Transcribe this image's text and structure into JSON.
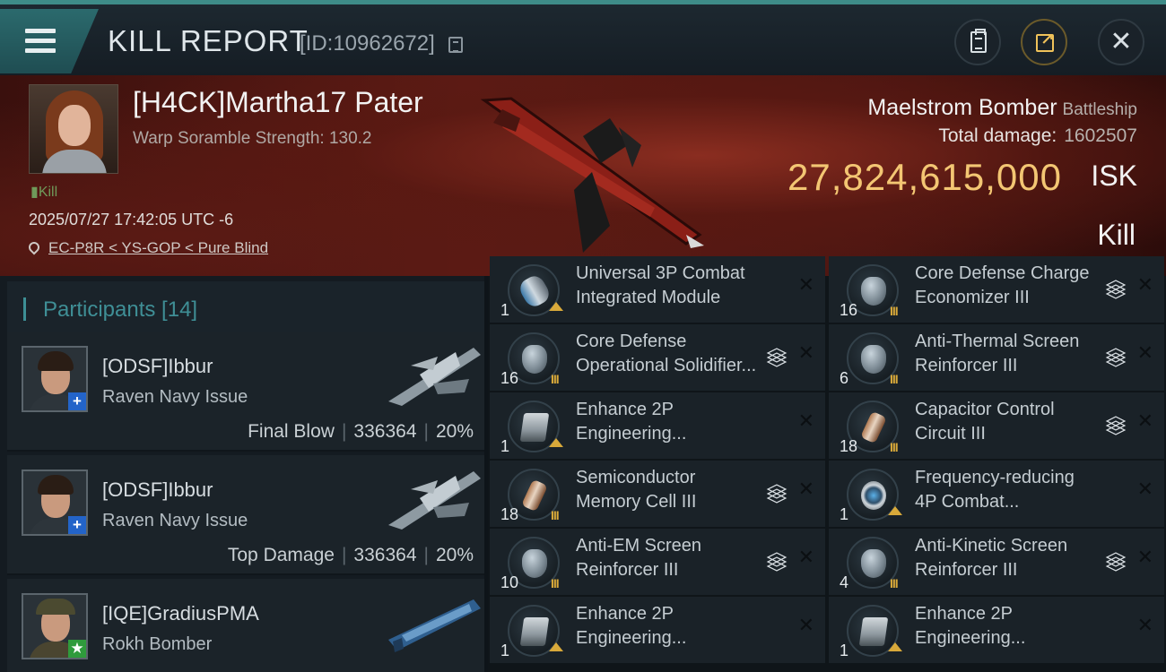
{
  "header": {
    "title": "KILL REPORT",
    "report_id": "[ID:10962672]"
  },
  "victim": {
    "name": "[H4CK]Martha17 Pater",
    "warp_scramble": "Warp Soramble Strength: 130.2",
    "kill_badge": "Kill",
    "timestamp": "2025/07/27 17:42:05 UTC -6",
    "location": "EC-P8R < YS-GOP < Pure Blind",
    "ship_name": "Maelstrom Bomber",
    "ship_class": "Battleship",
    "total_damage_label": "Total damage:",
    "total_damage_value": "1602507",
    "isk_value": "27,824,615,000",
    "isk_unit": "ISK",
    "result": "Kill"
  },
  "participants": {
    "title": "Participants [14]",
    "rows": [
      {
        "name": "[ODSF]Ibbur",
        "ship": "Raven Navy Issue",
        "role": "Final Blow",
        "damage": "336364",
        "percent": "20%",
        "badge": "+"
      },
      {
        "name": "[ODSF]Ibbur",
        "ship": "Raven Navy Issue",
        "role": "Top Damage",
        "damage": "336364",
        "percent": "20%",
        "badge": "+"
      },
      {
        "name": "[IQE]GradiusPMA",
        "ship": "Rokh Bomber",
        "role": "",
        "damage": "",
        "percent": "",
        "badge": "★"
      }
    ]
  },
  "modules": {
    "left": [
      {
        "line1": "Universal 3P Combat",
        "line2": "Integrated Module",
        "qty": "1",
        "tier": "",
        "stack": false
      },
      {
        "line1": "Core Defense",
        "line2": "Operational Solidifier...",
        "qty": "16",
        "tier": "III",
        "stack": true
      },
      {
        "line1": "Enhance 2P",
        "line2": "Engineering...",
        "qty": "1",
        "tier": "",
        "stack": false
      },
      {
        "line1": "Semiconductor",
        "line2": "Memory Cell III",
        "qty": "18",
        "tier": "III",
        "stack": true
      },
      {
        "line1": "Anti-EM Screen",
        "line2": "Reinforcer III",
        "qty": "10",
        "tier": "III",
        "stack": true
      },
      {
        "line1": "Enhance 2P",
        "line2": "Engineering...",
        "qty": "1",
        "tier": "",
        "stack": false
      }
    ],
    "right": [
      {
        "line1": "Core Defense Charge",
        "line2": "Economizer III",
        "qty": "16",
        "tier": "III",
        "stack": true
      },
      {
        "line1": "Anti-Thermal Screen",
        "line2": "Reinforcer III",
        "qty": "6",
        "tier": "III",
        "stack": true
      },
      {
        "line1": "Capacitor Control",
        "line2": "Circuit III",
        "qty": "18",
        "tier": "III",
        "stack": true
      },
      {
        "line1": "Frequency-reducing",
        "line2": "4P Combat...",
        "qty": "1",
        "tier": "",
        "stack": false
      },
      {
        "line1": "Anti-Kinetic Screen",
        "line2": "Reinforcer III",
        "qty": "4",
        "tier": "III",
        "stack": true
      },
      {
        "line1": "Enhance 2P",
        "line2": "Engineering...",
        "qty": "1",
        "tier": "",
        "stack": false
      }
    ]
  },
  "colors": {
    "accent_teal": "#3f8f96",
    "isk_gold": "#f3c673",
    "tier_gold": "#d8a93a"
  }
}
